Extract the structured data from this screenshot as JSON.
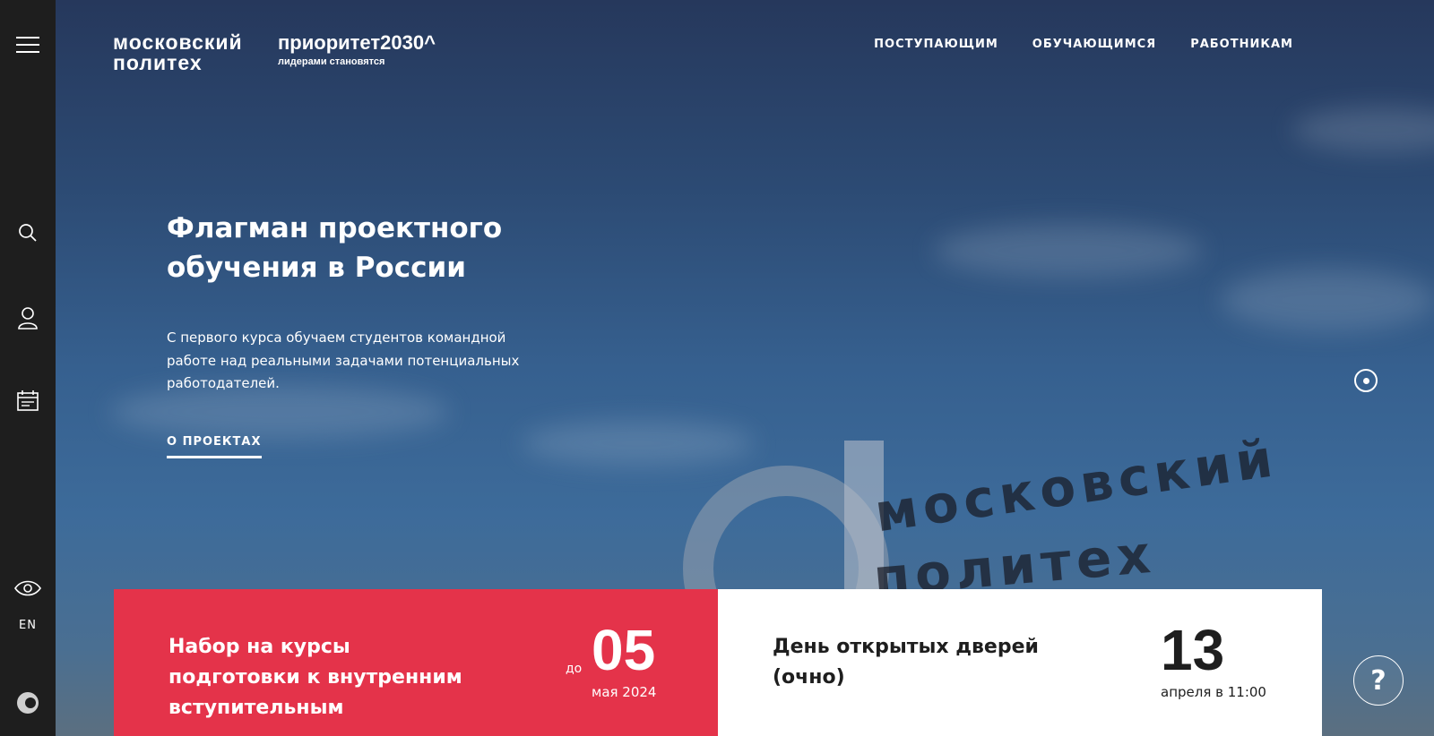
{
  "logo": {
    "line1": "московский",
    "line2": "политех"
  },
  "priority": {
    "title": "приоритет2030^",
    "tagline": "лидерами становятся"
  },
  "nav": {
    "items": [
      "ПОСТУПАЮЩИМ",
      "ОБУЧАЮЩИМСЯ",
      "РАБОТНИКАМ"
    ]
  },
  "sidebar": {
    "lang": "EN"
  },
  "hero": {
    "headline": "Флагман проектного обучения в России",
    "lead": "С первого курса обучаем студентов командной работе над реальными задачами потенциальных работодателей.",
    "link": "О ПРОЕКТАХ"
  },
  "background_sign": {
    "line1": "московский",
    "line2": "политех"
  },
  "cards": [
    {
      "title": "Набор на курсы подготовки к внутренним вступительным",
      "prefix": "до",
      "day": "05",
      "date": "мая 2024"
    },
    {
      "title": "День открытых дверей (очно)",
      "day": "13",
      "date": "апреля в 11:00"
    }
  ],
  "help": {
    "label": "?"
  },
  "colors": {
    "sidebar": "#1e1e1e",
    "accent_red": "#e4334a",
    "card_white": "#ffffff"
  }
}
